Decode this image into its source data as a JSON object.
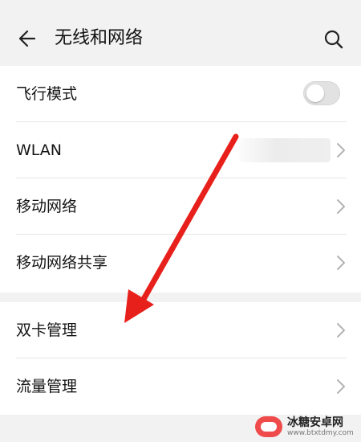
{
  "header": {
    "title": "无线和网络",
    "back_icon": "arrow-left-icon",
    "search_icon": "search-icon"
  },
  "settings": {
    "airplane": {
      "label": "飞行模式",
      "enabled": false
    },
    "wlan": {
      "label": "WLAN"
    },
    "mobile_network": {
      "label": "移动网络"
    },
    "tethering": {
      "label": "移动网络共享"
    },
    "dual_sim": {
      "label": "双卡管理"
    },
    "data_usage": {
      "label": "流量管理"
    }
  },
  "annotation": {
    "arrow_color": "#e8201c"
  },
  "watermark": {
    "name": "冰糖安卓网",
    "url": "www.btxtdmy.com"
  }
}
